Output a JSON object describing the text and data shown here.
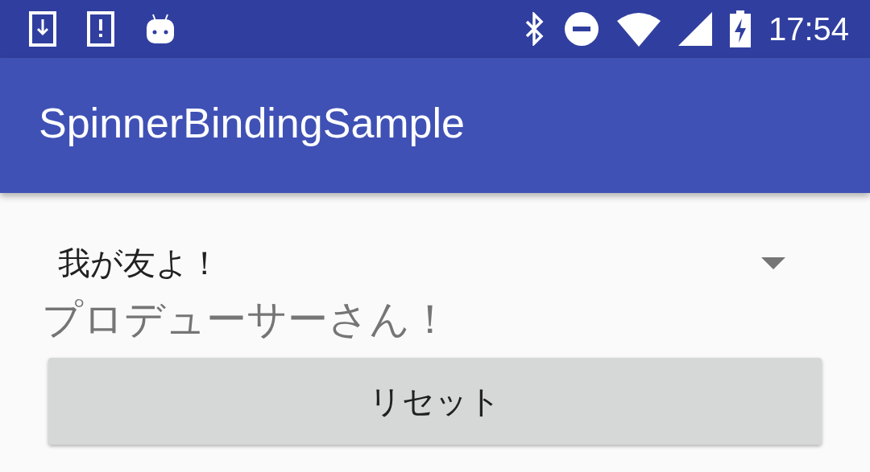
{
  "status_bar": {
    "time": "17:54"
  },
  "app_bar": {
    "title": "SpinnerBindingSample"
  },
  "spinner": {
    "value": "我が友よ！"
  },
  "label": "プロデューサーさん！",
  "button": "リセット"
}
